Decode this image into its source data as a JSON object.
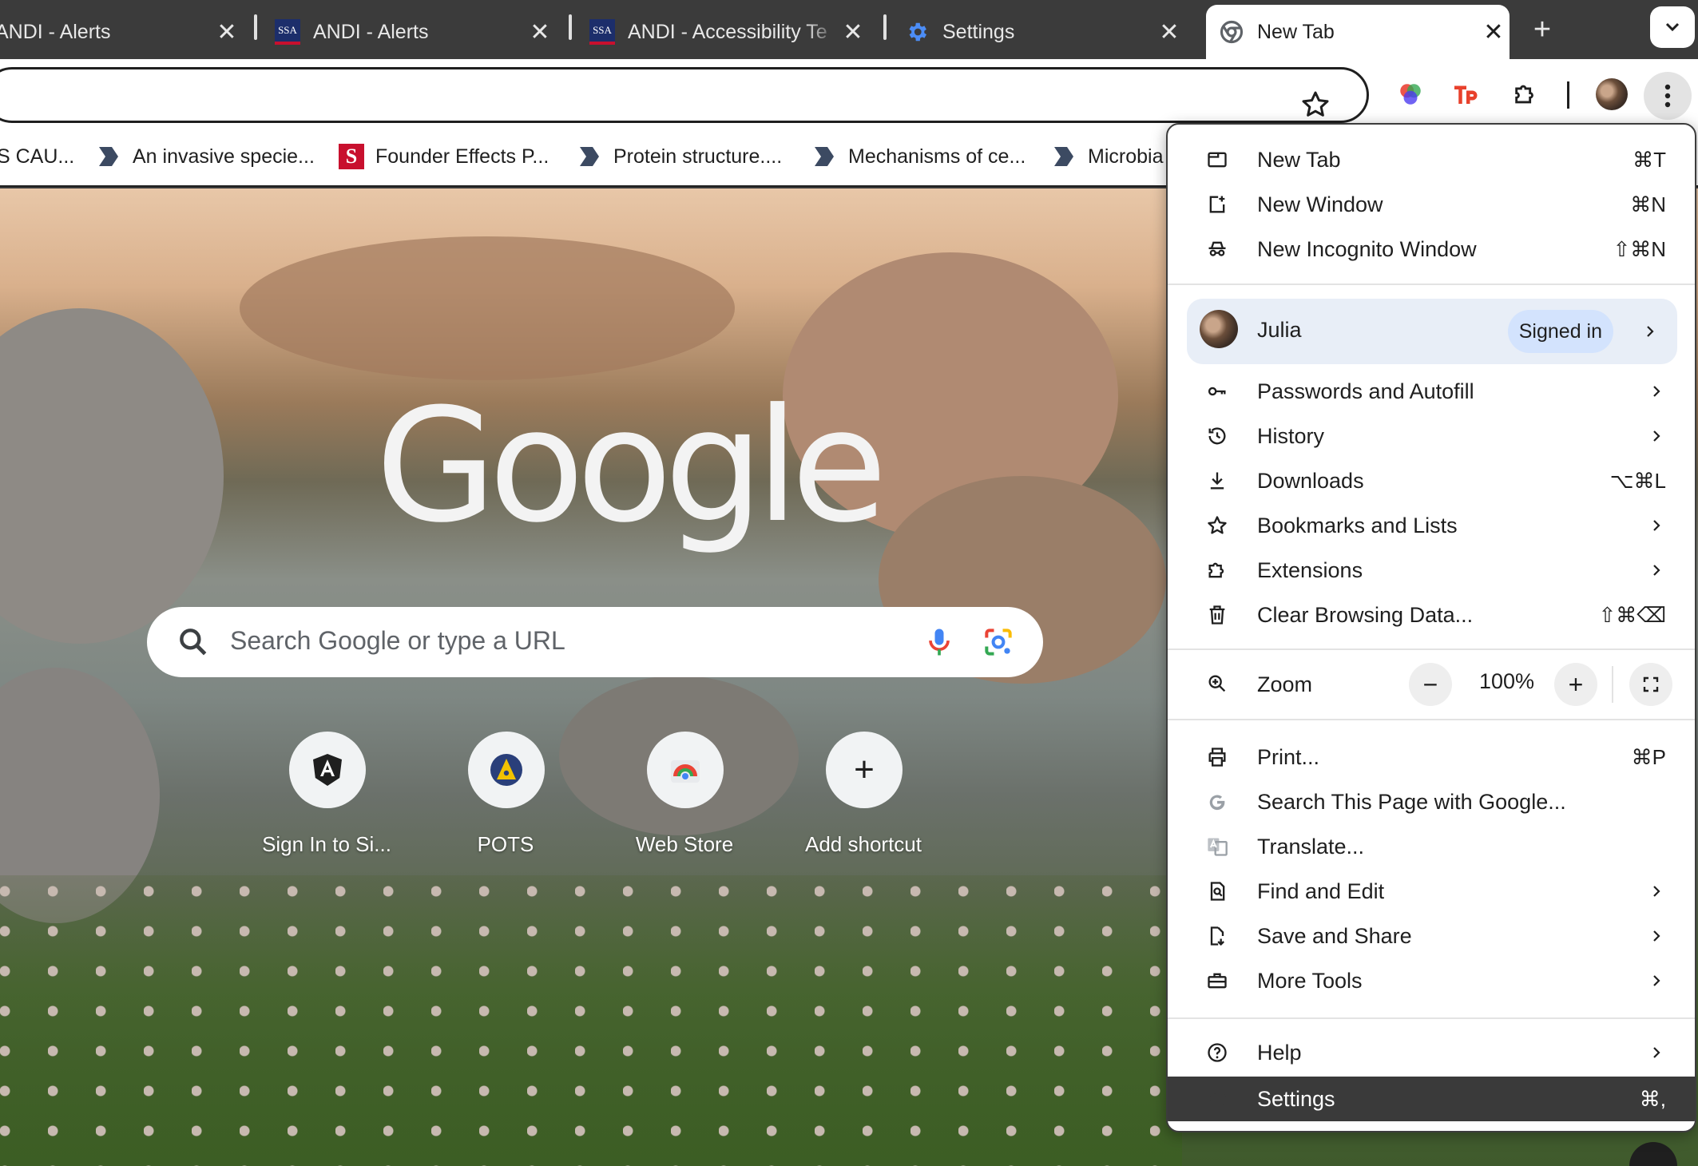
{
  "tabs": [
    {
      "title": "ANDI - Alerts",
      "icon": "andi-icon"
    },
    {
      "title": "ANDI - Alerts",
      "icon": "ssa-icon",
      "icon_text": "SSA"
    },
    {
      "title": "ANDI - Accessibility Te",
      "icon": "ssa-icon",
      "icon_text": "SSA"
    },
    {
      "title": "Settings",
      "icon": "gear-icon"
    },
    {
      "title": "New Tab",
      "icon": "chrome-icon",
      "active": true
    }
  ],
  "tab_controls": {
    "new_tab_symbol": "+",
    "close_symbol": "✕"
  },
  "bookmarks": [
    {
      "label": "S CAU..."
    },
    {
      "label": "An invasive specie...",
      "icon": "doc-bookmark-icon"
    },
    {
      "label": "Founder Effects P...",
      "icon": "s-logo-icon",
      "icon_text": "S"
    },
    {
      "label": "Protein structure....",
      "icon": "doc-bookmark-icon"
    },
    {
      "label": "Mechanisms of ce...",
      "icon": "doc-bookmark-icon"
    },
    {
      "label": "Microbia",
      "icon": "doc-bookmark-icon"
    }
  ],
  "ntp": {
    "logo": "Google",
    "search_placeholder": "Search Google or type a URL",
    "shortcuts": [
      {
        "label": "Sign In to Si...",
        "icon": "angular-icon"
      },
      {
        "label": "POTS",
        "icon": "pots-icon"
      },
      {
        "label": "Web Store",
        "icon": "webstore-icon"
      },
      {
        "label": "Add shortcut",
        "icon": "plus-icon",
        "symbol": "+"
      }
    ]
  },
  "menu": {
    "items_top": [
      {
        "label": "New Tab",
        "shortcut": "⌘T",
        "icon": "new-tab-icon"
      },
      {
        "label": "New Window",
        "shortcut": "⌘N",
        "icon": "new-window-icon"
      },
      {
        "label": "New Incognito Window",
        "shortcut": "⇧⌘N",
        "icon": "incognito-icon"
      }
    ],
    "profile": {
      "name": "Julia",
      "status": "Signed in"
    },
    "items_mid": [
      {
        "label": "Passwords and Autofill",
        "icon": "key-icon",
        "submenu": true
      },
      {
        "label": "History",
        "icon": "history-icon",
        "submenu": true
      },
      {
        "label": "Downloads",
        "shortcut": "⌥⌘L",
        "icon": "download-icon"
      },
      {
        "label": "Bookmarks and Lists",
        "icon": "star-icon",
        "submenu": true
      },
      {
        "label": "Extensions",
        "icon": "puzzle-icon",
        "submenu": true
      },
      {
        "label": "Clear Browsing Data...",
        "shortcut": "⇧⌘⌫",
        "icon": "trash-icon"
      }
    ],
    "zoom": {
      "label": "Zoom",
      "value": "100%",
      "minus": "−",
      "plus": "+"
    },
    "items_low": [
      {
        "label": "Print...",
        "shortcut": "⌘P",
        "icon": "print-icon"
      },
      {
        "label": "Search This Page with Google...",
        "icon": "google-g-icon"
      },
      {
        "label": "Translate...",
        "icon": "translate-icon"
      },
      {
        "label": "Find and Edit",
        "icon": "find-icon",
        "submenu": true
      },
      {
        "label": "Save and Share",
        "icon": "save-share-icon",
        "submenu": true
      },
      {
        "label": "More Tools",
        "icon": "toolbox-icon",
        "submenu": true
      }
    ],
    "items_bottom": [
      {
        "label": "Help",
        "icon": "help-icon",
        "submenu": true
      },
      {
        "label": "Settings",
        "shortcut": "⌘,",
        "icon": "settings-icon",
        "highlighted": true
      }
    ]
  },
  "colors": {
    "tabstrip": "#3b3b3b",
    "menu_highlight": "#3a3a3a",
    "profile_bg": "#e8eef7",
    "badge_bg": "#d3e3fd"
  }
}
